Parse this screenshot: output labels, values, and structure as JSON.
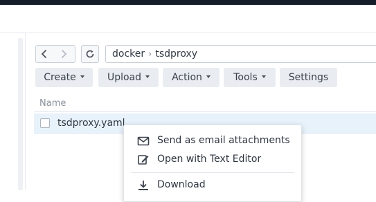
{
  "navigation": {
    "back_icon": "chevron-left-icon",
    "forward_icon": "chevron-right-icon",
    "refresh_icon": "refresh-icon",
    "path": [
      "docker",
      "tsdproxy"
    ],
    "separator": "›"
  },
  "toolbar": {
    "create_label": "Create",
    "upload_label": "Upload",
    "action_label": "Action",
    "tools_label": "Tools",
    "settings_label": "Settings"
  },
  "file_list": {
    "column_name": "Name",
    "rows": [
      {
        "name": "tsdproxy.yaml",
        "selected": true
      }
    ]
  },
  "context_menu": {
    "items": [
      {
        "label": "Send as email attachments",
        "icon": "envelope-icon"
      },
      {
        "label": "Open with Text Editor",
        "icon": "edit-icon"
      },
      {
        "label": "Download",
        "icon": "download-icon"
      }
    ]
  },
  "colors": {
    "topbar": "#151c2a",
    "selected_row": "#e8f2fb",
    "button_bg": "#e9ecf0"
  }
}
